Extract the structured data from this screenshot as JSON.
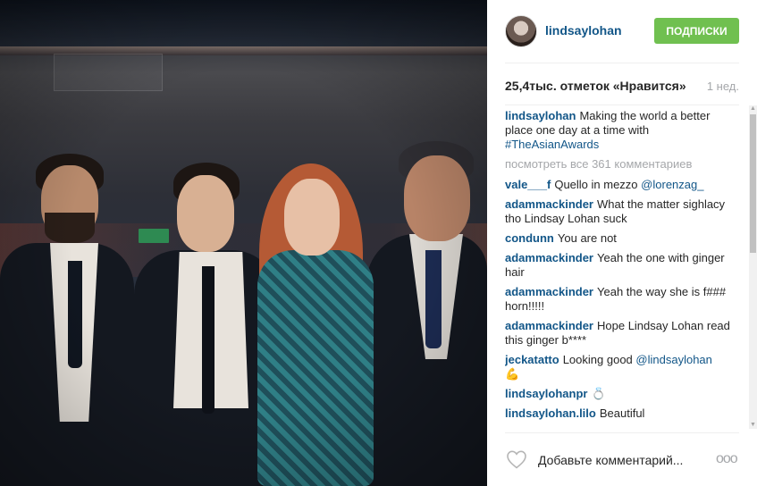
{
  "post": {
    "image_alt": "",
    "author": "lindsaylohan",
    "follow_label": "ПОДПИСКИ",
    "likes": "25,4тыс. отметок «Нравится»",
    "time": "1 нед."
  },
  "caption": {
    "user": "lindsaylohan",
    "text": "Making the world a better place one day at a time with",
    "hashtag": "#TheAsianAwards"
  },
  "view_all": "посмотреть все 361 комментариев",
  "comments": [
    {
      "user": "vale___f",
      "text": "Quello in mezzo",
      "mention": "@lorenzag_"
    },
    {
      "user": "adammackinder",
      "text": "What the matter sighlacy tho Lindsay Lohan suck"
    },
    {
      "user": "condunn",
      "text": "You are not"
    },
    {
      "user": "adammackinder",
      "text": "Yeah the one with ginger hair"
    },
    {
      "user": "adammackinder",
      "text": "Yeah the way she is f### horn!!!!!"
    },
    {
      "user": "adammackinder",
      "text": "Hope Lindsay Lohan read this ginger b****"
    },
    {
      "user": "jeckatatto",
      "text": "Looking good",
      "mention": "@lindsaylohan",
      "emoji": "💪"
    },
    {
      "user": "lindsaylohanpr",
      "text": "💍"
    },
    {
      "user": "lindsaylohan.lilo",
      "text": "Beautiful"
    }
  ],
  "footer": {
    "add_comment_placeholder": "Добавьте комментарий...",
    "more": "ooo"
  },
  "colors": {
    "link": "#125688",
    "follow_button": "#70c050",
    "muted": "#a5a7aa"
  }
}
